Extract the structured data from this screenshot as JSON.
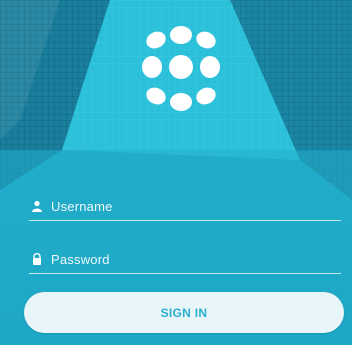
{
  "login": {
    "username_placeholder": "Username",
    "password_placeholder": "Password",
    "signin_label": "SIGN IN"
  },
  "icons": {
    "username": "user-icon",
    "password": "lock-icon",
    "logo": "dots-logo"
  },
  "colors": {
    "background": "#1fa9c6",
    "button_bg": "#e8f6f9",
    "button_text": "#2aaed0"
  }
}
